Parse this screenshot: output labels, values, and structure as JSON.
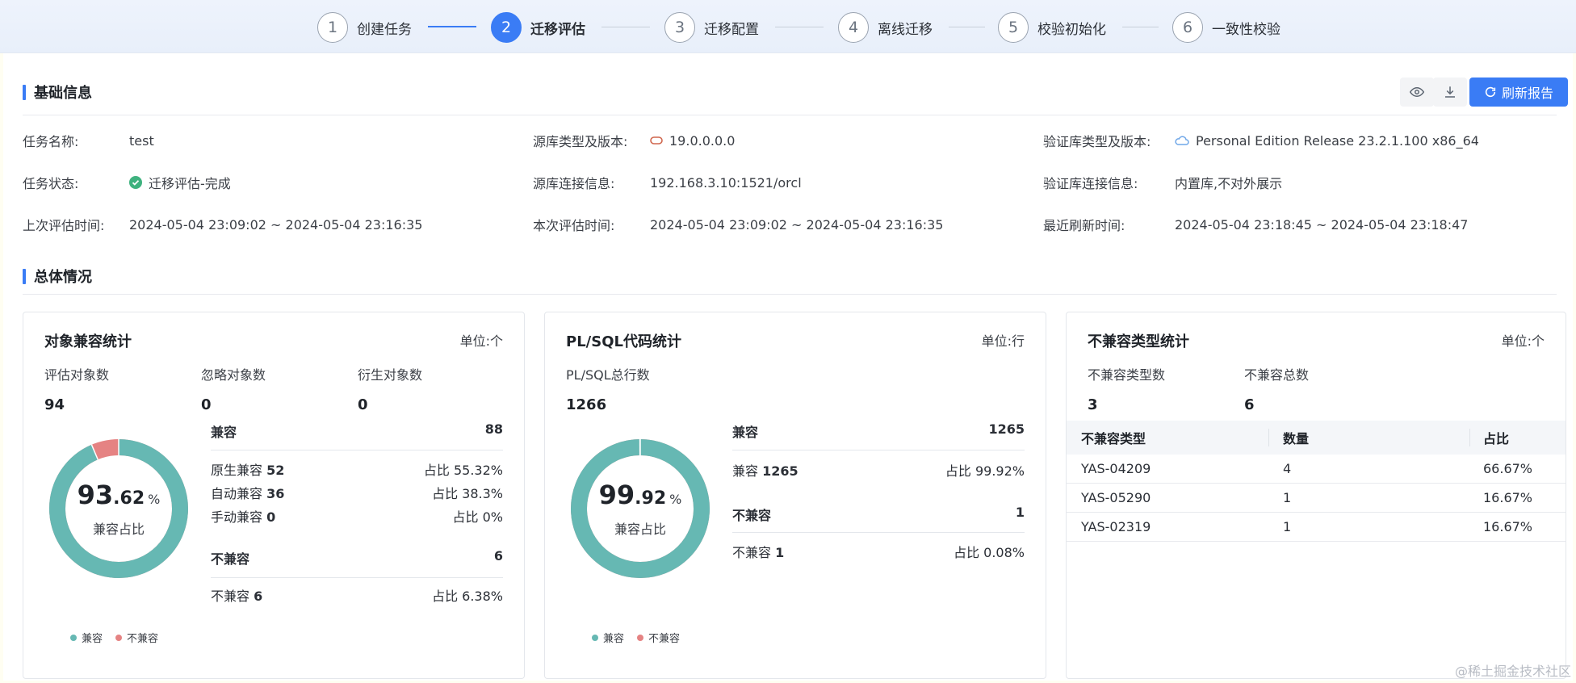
{
  "steps": [
    {
      "num": "1",
      "label": "创建任务"
    },
    {
      "num": "2",
      "label": "迁移评估"
    },
    {
      "num": "3",
      "label": "迁移配置"
    },
    {
      "num": "4",
      "label": "离线迁移"
    },
    {
      "num": "5",
      "label": "校验初始化"
    },
    {
      "num": "6",
      "label": "一致性校验"
    }
  ],
  "active_step": 2,
  "basic": {
    "title": "基础信息",
    "refresh_label": "刷新报告",
    "fields": {
      "task_name_label": "任务名称:",
      "task_name": "test",
      "source_type_label": "源库类型及版本:",
      "source_type": "19.0.0.0.0",
      "verify_type_label": "验证库类型及版本:",
      "verify_type": "Personal Edition Release 23.2.1.100 x86_64",
      "task_status_label": "任务状态:",
      "task_status": "迁移评估-完成",
      "source_conn_label": "源库连接信息:",
      "source_conn": "192.168.3.10:1521/orcl",
      "verify_conn_label": "验证库连接信息:",
      "verify_conn": "内置库,不对外展示",
      "last_eval_label": "上次评估时间:",
      "last_eval": "2024-05-04 23:09:02 ~ 2024-05-04 23:16:35",
      "this_eval_label": "本次评估时间:",
      "this_eval": "2024-05-04 23:09:02 ~ 2024-05-04 23:16:35",
      "recent_refresh_label": "最近刷新时间:",
      "recent_refresh": "2024-05-04 23:18:45 ~ 2024-05-04 23:18:47"
    }
  },
  "overview": {
    "title": "总体情况",
    "object_card": {
      "title": "对象兼容统计",
      "unit": "单位:个",
      "stats": [
        {
          "label": "评估对象数",
          "value": "94"
        },
        {
          "label": "忽略对象数",
          "value": "0"
        },
        {
          "label": "衍生对象数",
          "value": "0"
        }
      ],
      "donut": {
        "pct_int": "93",
        "pct_dec": ".62",
        "pct_sym": "%",
        "caption": "兼容占比",
        "compatible_fraction": 0.9362
      },
      "compat_head": {
        "label": "兼容",
        "value": "88"
      },
      "compat_rows": [
        {
          "name": "原生兼容",
          "count": "52",
          "ratio": "占比 55.32%"
        },
        {
          "name": "自动兼容",
          "count": "36",
          "ratio": "占比 38.3%"
        },
        {
          "name": "手动兼容",
          "count": "0",
          "ratio": "占比 0%"
        }
      ],
      "incompat_head": {
        "label": "不兼容",
        "value": "6"
      },
      "incompat_rows": [
        {
          "name": "不兼容",
          "count": "6",
          "ratio": "占比 6.38%"
        }
      ],
      "legend": {
        "compatible": "兼容",
        "incompatible": "不兼容"
      }
    },
    "plsql_card": {
      "title": "PL/SQL代码统计",
      "unit": "单位:行",
      "stats": [
        {
          "label": "PL/SQL总行数",
          "value": "1266"
        }
      ],
      "donut": {
        "pct_int": "99",
        "pct_dec": ".92",
        "pct_sym": "%",
        "caption": "兼容占比",
        "compatible_fraction": 0.9992
      },
      "compat_head": {
        "label": "兼容",
        "value": "1265"
      },
      "compat_rows": [
        {
          "name": "兼容",
          "count": "1265",
          "ratio": "占比 99.92%"
        }
      ],
      "incompat_head": {
        "label": "不兼容",
        "value": "1"
      },
      "incompat_rows": [
        {
          "name": "不兼容",
          "count": "1",
          "ratio": "占比 0.08%"
        }
      ],
      "legend": {
        "compatible": "兼容",
        "incompatible": "不兼容"
      }
    },
    "incompat_card": {
      "title": "不兼容类型统计",
      "unit": "单位:个",
      "stats": [
        {
          "label": "不兼容类型数",
          "value": "3"
        },
        {
          "label": "不兼容总数",
          "value": "6"
        }
      ],
      "table": {
        "headers": [
          "不兼容类型",
          "数量",
          "占比"
        ],
        "rows": [
          [
            "YAS-04209",
            "4",
            "66.67%"
          ],
          [
            "YAS-05290",
            "1",
            "16.67%"
          ],
          [
            "YAS-02319",
            "1",
            "16.67%"
          ]
        ]
      }
    }
  },
  "colors": {
    "accent": "#3a7cf5",
    "compatible": "#66b8b3",
    "incompatible": "#e58383",
    "success": "#3fb27f"
  },
  "watermark": "@稀土掘金技术社区"
}
